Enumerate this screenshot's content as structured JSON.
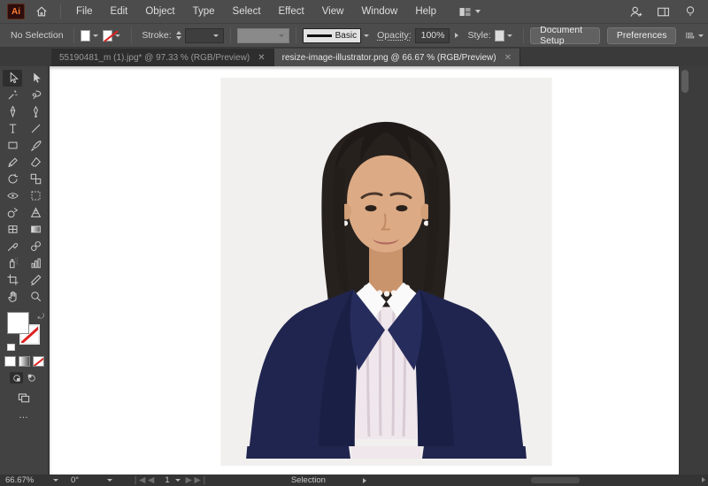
{
  "app": {
    "logo_text": "Ai"
  },
  "menu_bar": {
    "items": [
      "File",
      "Edit",
      "Object",
      "Type",
      "Select",
      "Effect",
      "View",
      "Window",
      "Help"
    ],
    "right_icons": [
      "share-user-icon",
      "arrange-documents-icon",
      "discover-lightbulb-icon"
    ]
  },
  "control_bar": {
    "selection_status": "No Selection",
    "fill_color": "#ffffff",
    "stroke_color": "none",
    "stroke_label": "Stroke:",
    "brush_definition": "Basic",
    "opacity_label": "Opacity:",
    "opacity_value": "100%",
    "style_label": "Style:",
    "document_setup_label": "Document Setup",
    "preferences_label": "Preferences"
  },
  "tab_bar": {
    "tabs": [
      {
        "title": "55190481_m (1).jpg* @ 97.33 % (RGB/Preview)",
        "active": false,
        "close_glyph": "✕"
      },
      {
        "title": "resize-image-illustrator.png @ 66.67 % (RGB/Preview)",
        "active": true,
        "close_glyph": "✕"
      }
    ]
  },
  "toolbar": {
    "tools": [
      {
        "name": "selection",
        "icon": "selection",
        "active": true
      },
      {
        "name": "direct-selection",
        "icon": "direct-selection",
        "active": false
      },
      {
        "name": "magic-wand",
        "icon": "magic-wand",
        "active": false
      },
      {
        "name": "lasso",
        "icon": "lasso",
        "active": false
      },
      {
        "name": "pen",
        "icon": "pen",
        "active": false
      },
      {
        "name": "curvature",
        "icon": "curvature",
        "active": false
      },
      {
        "name": "type",
        "icon": "type",
        "active": false
      },
      {
        "name": "line-segment",
        "icon": "line",
        "active": false
      },
      {
        "name": "rectangle",
        "icon": "rect",
        "active": false
      },
      {
        "name": "paintbrush",
        "icon": "brush",
        "active": false
      },
      {
        "name": "pencil",
        "icon": "pencil",
        "active": false
      },
      {
        "name": "eraser",
        "icon": "eraser",
        "active": false
      },
      {
        "name": "rotate",
        "icon": "rotate",
        "active": false
      },
      {
        "name": "scale",
        "icon": "scale",
        "active": false
      },
      {
        "name": "width",
        "icon": "width",
        "active": false
      },
      {
        "name": "free-transform",
        "icon": "free-transform",
        "active": false
      },
      {
        "name": "shape-builder",
        "icon": "shape-builder",
        "active": false
      },
      {
        "name": "perspective-grid",
        "icon": "perspective-grid",
        "active": false
      },
      {
        "name": "mesh",
        "icon": "mesh",
        "active": false
      },
      {
        "name": "gradient",
        "icon": "gradient",
        "active": false
      },
      {
        "name": "eyedropper",
        "icon": "eyedropper",
        "active": false
      },
      {
        "name": "blend",
        "icon": "blend",
        "active": false
      },
      {
        "name": "symbol-sprayer",
        "icon": "spray",
        "active": false
      },
      {
        "name": "column-graph",
        "icon": "graph",
        "active": false
      },
      {
        "name": "artboard",
        "icon": "artboard",
        "active": false
      },
      {
        "name": "slice",
        "icon": "slice",
        "active": false
      },
      {
        "name": "hand",
        "icon": "hand",
        "active": false
      },
      {
        "name": "zoom",
        "icon": "zoom-tool",
        "active": false
      }
    ],
    "swap_glyph": "⤾",
    "ellipsis": "…"
  },
  "status_bar": {
    "zoom_level": "66.67%",
    "rotation": "0°",
    "artboard_number": "1",
    "status_text": "Selection"
  },
  "canvas": {
    "photo_colors": {
      "background": "#f1f0ee",
      "hair": "#27211e",
      "skin": "#dcab85",
      "blazer": "#20254f",
      "blouse": "#efe7ec",
      "collar": "#fbfafa",
      "lips": "#b06a60"
    }
  }
}
